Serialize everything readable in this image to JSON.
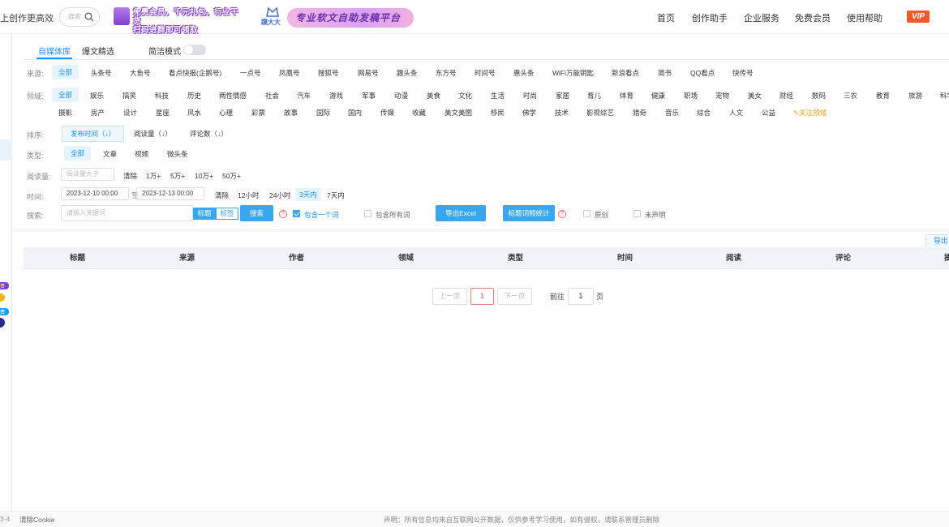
{
  "header": {
    "slogan": "上创作更高效",
    "search_placeholder": "搜索",
    "banner1_text_line1": "免费会员，千元礼包，行业干货",
    "banner1_text_line2": "扫码进群即可领取",
    "logo2_text": "蹼大大",
    "banner2_text": "专业软文自助发稿平台",
    "nav": [
      "首页",
      "创作助手",
      "企业服务",
      "免费会员",
      "使用帮助"
    ],
    "vip": "VIP"
  },
  "tabs": {
    "items": [
      "自媒体库",
      "爆文精选"
    ],
    "active": "自媒体库",
    "simple_mode_label": "简洁模式"
  },
  "filters": {
    "source_label": "来源:",
    "sources": [
      "全部",
      "头条号",
      "大鱼号",
      "看点快报(企鹅号)",
      "一点号",
      "凤凰号",
      "搜狐号",
      "网易号",
      "趣头条",
      "东方号",
      "时间号",
      "惠头条",
      "WiFi万能钥匙",
      "新浪看点",
      "简书",
      "QQ看点",
      "快传号"
    ],
    "field_label": "领域:",
    "fields_row1": [
      "全部",
      "娱乐",
      "搞笑",
      "科技",
      "历史",
      "两性情感",
      "社会",
      "汽车",
      "游戏",
      "军事",
      "动漫",
      "美食",
      "文化",
      "生活",
      "时尚",
      "家居",
      "育儿",
      "体育",
      "健康",
      "职场",
      "宠物",
      "美女",
      "财经",
      "数码",
      "三农",
      "教育",
      "旅游",
      "科学"
    ],
    "fields_row2": [
      "摄影",
      "房产",
      "设计",
      "星座",
      "风水",
      "心理",
      "彩票",
      "故事",
      "国际",
      "国内",
      "传媒",
      "收藏",
      "美文美图",
      "移民",
      "佛学",
      "技术",
      "影视综艺",
      "猎奇",
      "音乐",
      "综合",
      "人文",
      "公益"
    ],
    "follow_field": "关注领域",
    "sort_label": "排序:",
    "sorts": [
      "发布时间（↓）",
      "阅读量（↓）",
      "评论数（↓）"
    ],
    "type_label": "类型:",
    "types": [
      "全部",
      "文章",
      "视频",
      "微头条"
    ],
    "reads_label": "阅读量:",
    "reads_placeholder": "阅读量大于",
    "reads_clear": "清除",
    "reads_presets": [
      "1万+",
      "5万+",
      "10万+",
      "50万+"
    ],
    "time_label": "时间:",
    "time_start": "2023-12-10 00:00",
    "time_sep": "至",
    "time_end": "2023-12-13 00:00",
    "time_clear": "清除",
    "time_presets": [
      "12小时",
      "24小时",
      "3天内",
      "7天内"
    ],
    "search_label": "搜索:",
    "search_placeholder": "请输入关键词",
    "search_mode": [
      "标题",
      "标签"
    ],
    "search_button": "搜索",
    "qmark": "?",
    "contains_one": "包含一个词",
    "contains_all": "包含所有词",
    "export_excel": "导出Excel",
    "title_stats": "标题词频统计",
    "original": "原创",
    "undeclared": "未声明"
  },
  "table": {
    "export_tab": "导出",
    "headers": [
      "标题",
      "来源",
      "作者",
      "领域",
      "类型",
      "时间",
      "阅读",
      "评论",
      "操"
    ]
  },
  "pagination": {
    "prev": "上一页",
    "current": "1",
    "next": "下一页",
    "goto_prefix": "前往",
    "goto_value": "1",
    "goto_suffix": "页"
  },
  "left_strip": {
    "badge1": "费",
    "badge2": "费"
  },
  "footer": {
    "left_fragment": "3-4",
    "clear_cookie": "清除Cookie",
    "disclaimer": "声明：所有信息均来自互联网公开数据，仅供参考学习使用，如有侵权，请联系管理员删除"
  }
}
